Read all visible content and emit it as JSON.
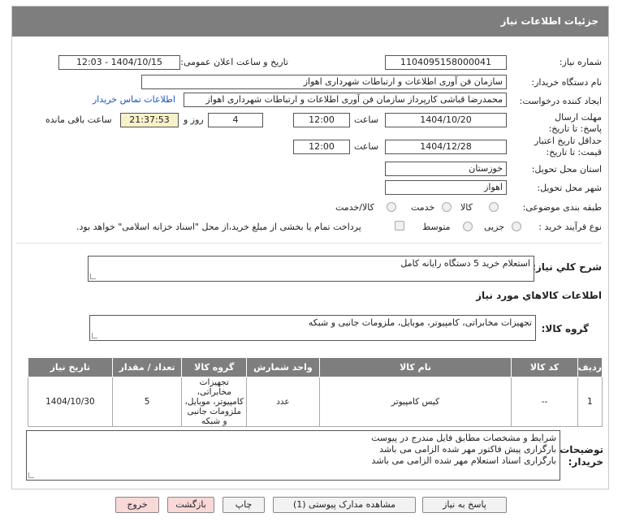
{
  "header": {
    "title": "جزئیات اطلاعات نیاز"
  },
  "form": {
    "need_number": {
      "label": "شماره نیاز:",
      "value": "1104095158000041"
    },
    "announce_date": {
      "label": "تاریخ و ساعت اعلان عمومی:",
      "value": "1404/10/15 - 12:03"
    },
    "buyer_org": {
      "label": "نام دستگاه خریدار:",
      "value": "سازمان فن آوری اطلاعات و ارتباطات شهرداری اهواز"
    },
    "creator": {
      "label": "ایجاد کننده درخواست:",
      "value": "محمدرضا قباشی کارپرداز سازمان فن آوری اطلاعات و ارتباطات شهرداری اهواز",
      "contact_link": "اطلاعات تماس خریدار"
    },
    "reply_deadline": {
      "label": "مهلت ارسال پاسخ: تا تاریخ:",
      "date": "1404/10/20",
      "time_label": "ساعت",
      "time": "12:00",
      "days": "4",
      "days_label": "روز و",
      "remaining": "21:37:53",
      "remaining_label": "ساعت باقی مانده"
    },
    "price_validity": {
      "label": "حداقل تاریخ اعتبار قیمت: تا تاریخ:",
      "date": "1404/12/28",
      "time_label": "ساعت",
      "time": "12:00"
    },
    "province": {
      "label": "استان محل تحویل:",
      "value": "خوزستان"
    },
    "city": {
      "label": "شهر محل تحویل:",
      "value": "اهواز"
    },
    "category": {
      "label": "طبقه بندی موضوعی:",
      "options": [
        "کالا",
        "خدمت",
        "کالا/خدمت"
      ]
    },
    "purchase_type": {
      "label": "نوع فرآیند خرید :",
      "options": [
        "جزیی",
        "متوسط"
      ],
      "payment_note": "پرداخت تمام یا بخشی از مبلغ خرید،از محل \"اسناد خزانه اسلامی\" خواهد بود."
    },
    "summary": {
      "label": "شرح کلي نياز:",
      "value": "استعلام خرید 5 دستگاه رایانه کامل"
    },
    "goods_section_title": "اطلاعات کالاهاي مورد نياز",
    "goods_group": {
      "label": "گروه کالا:",
      "value": "تجهیزات مخابراتی، کامپیوتر، موبایل، ملزومات جانبی و شبکه"
    }
  },
  "table": {
    "headers": [
      "ردیف",
      "کد کالا",
      "نام کالا",
      "واحد شمارش",
      "گروه کالا",
      "تعداد / مقدار",
      "تاریخ نیاز"
    ],
    "rows": [
      [
        "1",
        "--",
        "کیس کامپیوتر",
        "عدد",
        "تجهیزات مخابراتی، کامپیوتر، موبایل، ملزومات جانبی و شبکه",
        "5",
        "1404/10/30"
      ]
    ]
  },
  "buyer_notes": {
    "label": "توضیحات خریدار:",
    "lines": [
      "شرایط و مشخصات مطابق فایل مندرج در پیوست",
      "بارگزاری پیش فاکتور مهر شده الزامی می باشد",
      "بارگزاری اسناد استعلام مهر شده الزامی می باشد"
    ]
  },
  "buttons": {
    "reply": "پاسخ به نیاز",
    "attachments": "مشاهده مدارک پیوستی (1)",
    "print": "چاپ",
    "back": "بازگشت",
    "exit": "خروج"
  },
  "watermark": {
    "text": "AriaTender.neT"
  },
  "colors": {
    "header_bg": "#7e7e7e",
    "link": "#1a55c8",
    "remaining_bg": "#f8f2c8",
    "pink_button": "#f9d8d8",
    "watermark": "#c0392b"
  }
}
